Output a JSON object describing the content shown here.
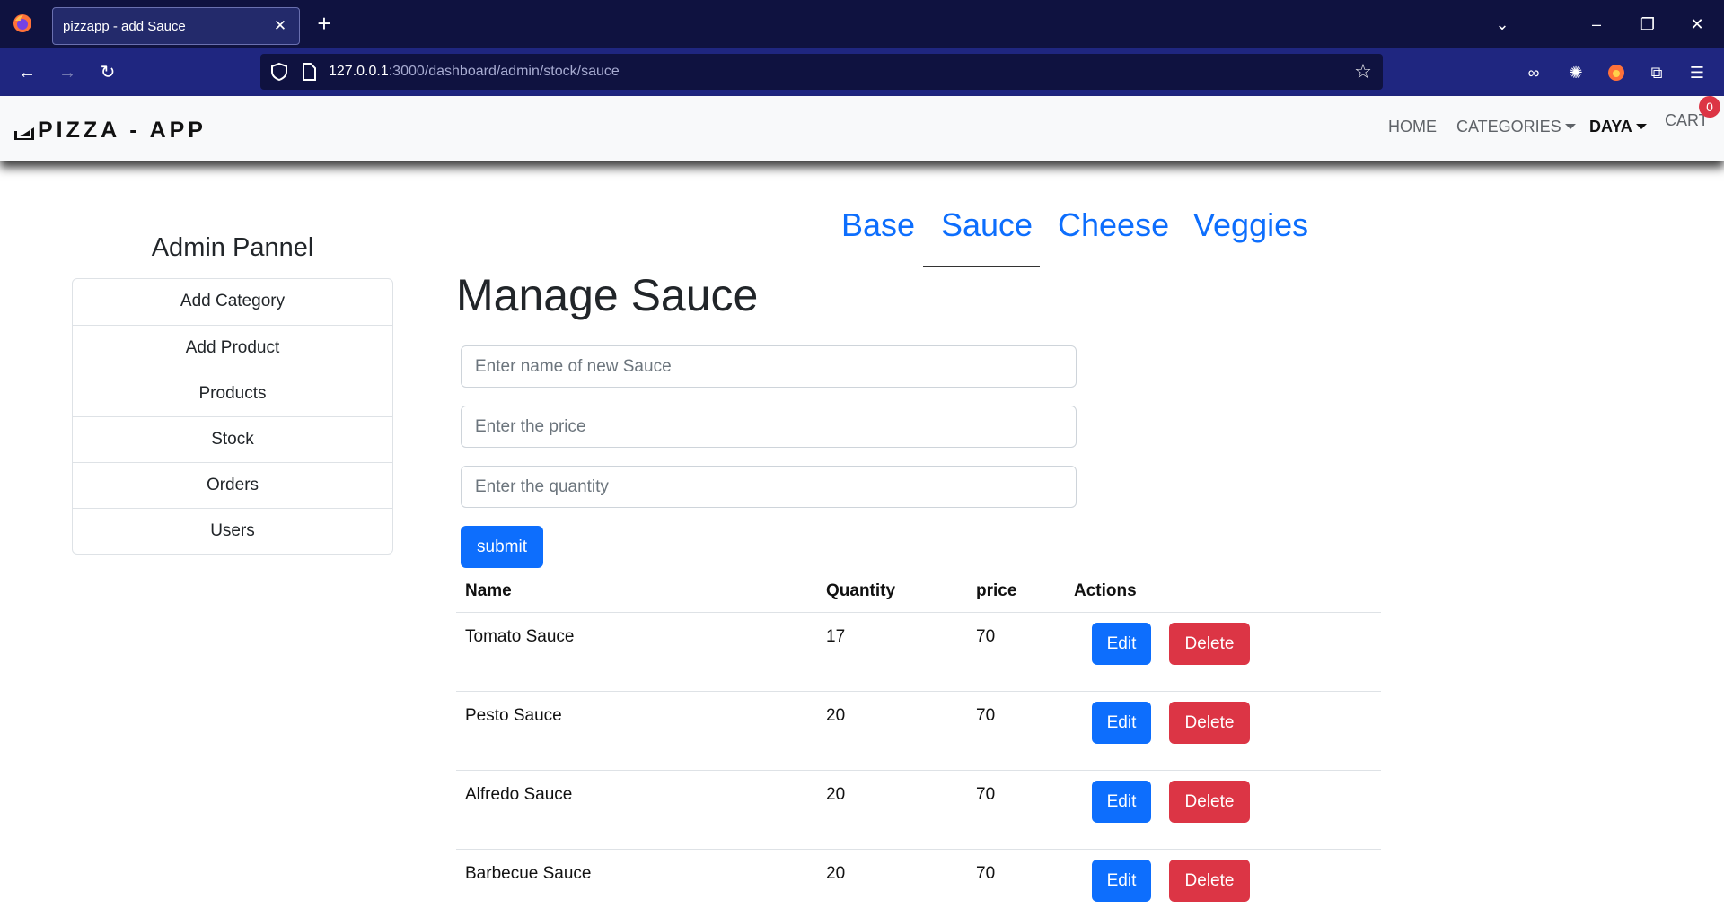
{
  "browser": {
    "tab_title": "pizzapp - add Sauce",
    "url_host": "127.0.0.1",
    "url_path": ":3000/dashboard/admin/stock/sauce"
  },
  "app": {
    "brand": "PIZZA - APP",
    "nav": {
      "home": "HOME",
      "categories": "CATEGORIES",
      "user": "DAYA",
      "cart": "CART",
      "cart_count": "0"
    }
  },
  "sidebar": {
    "title": "Admin Pannel",
    "items": [
      "Add Category",
      "Add Product",
      "Products",
      "Stock",
      "Orders",
      "Users"
    ]
  },
  "tabs": {
    "base": "Base",
    "sauce": "Sauce",
    "cheese": "Cheese",
    "veggies": "Veggies",
    "active": "Sauce"
  },
  "form": {
    "title": "Manage Sauce",
    "name_placeholder": "Enter name of new Sauce",
    "price_placeholder": "Enter the price",
    "quantity_placeholder": "Enter the quantity",
    "submit_label": "submit"
  },
  "table": {
    "headers": {
      "name": "Name",
      "quantity": "Quantity",
      "price": "price",
      "actions": "Actions"
    },
    "rows": [
      {
        "name": "Tomato Sauce",
        "quantity": "17",
        "price": "70"
      },
      {
        "name": "Pesto Sauce",
        "quantity": "20",
        "price": "70"
      },
      {
        "name": "Alfredo Sauce",
        "quantity": "20",
        "price": "70"
      },
      {
        "name": "Barbecue Sauce",
        "quantity": "20",
        "price": "70"
      }
    ],
    "edit_label": "Edit",
    "delete_label": "Delete"
  },
  "colors": {
    "primary": "#0d6efd",
    "danger": "#dc3545",
    "browser_dark": "#0f1240",
    "browser_nav": "#1f2680"
  },
  "icons": [
    "firefox-icon",
    "close-icon",
    "plus-icon",
    "back-icon",
    "forward-icon",
    "reload-icon",
    "shield-icon",
    "page-icon",
    "star-icon",
    "mask-icon",
    "cookie-icon",
    "fox-extension-icon",
    "puzzle-icon",
    "hamburger-icon",
    "pizza-icon"
  ]
}
